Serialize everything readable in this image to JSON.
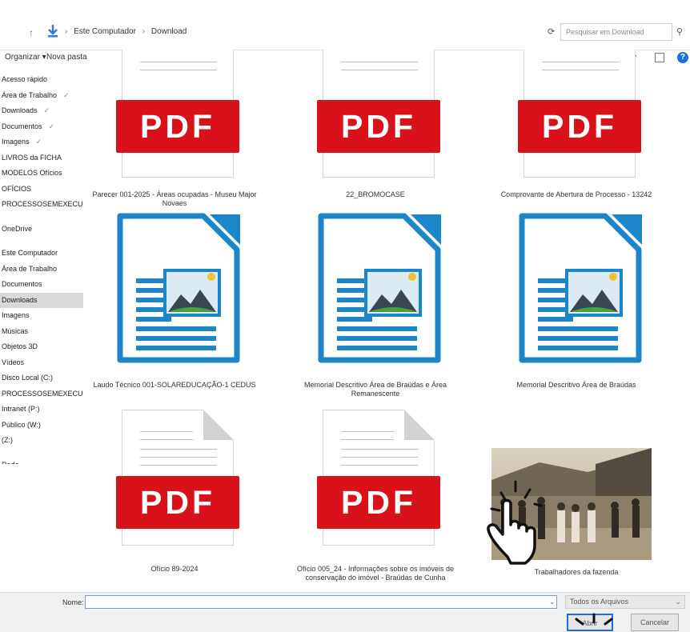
{
  "address": {
    "path": [
      "Este Computador",
      "Download"
    ]
  },
  "search": {
    "placeholder": "Pesquisar em Download"
  },
  "toolbar": {
    "organize": "Organizar ▾",
    "new_folder": "Nova pasta",
    "view": "▦ ▾",
    "help": "?"
  },
  "sidebar": {
    "items": [
      {
        "label": "Acesso rápido",
        "pin": "",
        "selected": false
      },
      {
        "label": "Área de Trabalho",
        "pin": "✓",
        "selected": false
      },
      {
        "label": "Downloads",
        "pin": "✓",
        "selected": false
      },
      {
        "label": "Documentos",
        "pin": "✓",
        "selected": false
      },
      {
        "label": "Imagens",
        "pin": "✓",
        "selected": false
      },
      {
        "label": "LIVROS da FICHA",
        "pin": "",
        "selected": false
      },
      {
        "label": "MODELOS Ofícios",
        "pin": "",
        "selected": false
      },
      {
        "label": "OFÍCIOS",
        "pin": "",
        "selected": false
      },
      {
        "label": "PROCESSOSEMEXECUÇÃO",
        "pin": "",
        "selected": false
      },
      {
        "gap": true
      },
      {
        "label": "OneDrive",
        "pin": "",
        "selected": false
      },
      {
        "gap": true
      },
      {
        "label": "Este Computador",
        "pin": "",
        "selected": false
      },
      {
        "label": "Área de Trabalho",
        "pin": "",
        "selected": false
      },
      {
        "label": "Documentos",
        "pin": "",
        "selected": false
      },
      {
        "label": "Downloads",
        "pin": "",
        "selected": true
      },
      {
        "label": "Imagens",
        "pin": "",
        "selected": false
      },
      {
        "label": "Músicas",
        "pin": "",
        "selected": false
      },
      {
        "label": "Objetos 3D",
        "pin": "",
        "selected": false
      },
      {
        "label": "Vídeos",
        "pin": "",
        "selected": false
      },
      {
        "label": "Disco Local (C:)",
        "pin": "",
        "selected": false
      },
      {
        "label": "PROCESSOSEMEXECUÇÃO",
        "pin": "",
        "selected": false
      },
      {
        "label": "Intranet (P:)",
        "pin": "",
        "selected": false
      },
      {
        "label": "Público (W:)",
        "pin": "",
        "selected": false
      },
      {
        "label": "(Z:)",
        "pin": "",
        "selected": false
      },
      {
        "gap": true
      },
      {
        "label": "Rede",
        "pin": "",
        "selected": false
      }
    ]
  },
  "files": [
    {
      "type": "pdf",
      "label": "Parecer 001-2025 - Áreas ocupadas - Museu Major Novaes"
    },
    {
      "type": "pdf",
      "label": "22_BROMOCASE"
    },
    {
      "type": "pdf",
      "label": "Comprovante de Abertura de Processo - 13242"
    },
    {
      "type": "odg",
      "label": "Laudo Técnico 001-SOLAREDUCAÇÃO-1 CEDUS"
    },
    {
      "type": "odg",
      "label": "Memorial Descritivo Área de Braúdas e Área Remanescente"
    },
    {
      "type": "odg",
      "label": "Memorial Descritivo Área de Braúdas"
    },
    {
      "type": "pdf",
      "label": "Ofício 89-2024"
    },
    {
      "type": "pdf",
      "label": "Ofício 005_24 - Informações sobre os imóveis de conservação do imóvel - Braúdas de Cunha"
    },
    {
      "type": "photo",
      "label": "Trabalhadores da fazenda"
    }
  ],
  "icons": {
    "pdf_text": "PDF"
  },
  "bottom": {
    "name_label": "Nome:",
    "name_value": "",
    "filter_value": "Todos os Arquivos",
    "open_label": "Abrir",
    "cancel_label": "Cancelar"
  },
  "colors": {
    "pdf_red": "#d9111a",
    "odg_blue": "#1d86c8",
    "accent": "#1e6fd9"
  }
}
